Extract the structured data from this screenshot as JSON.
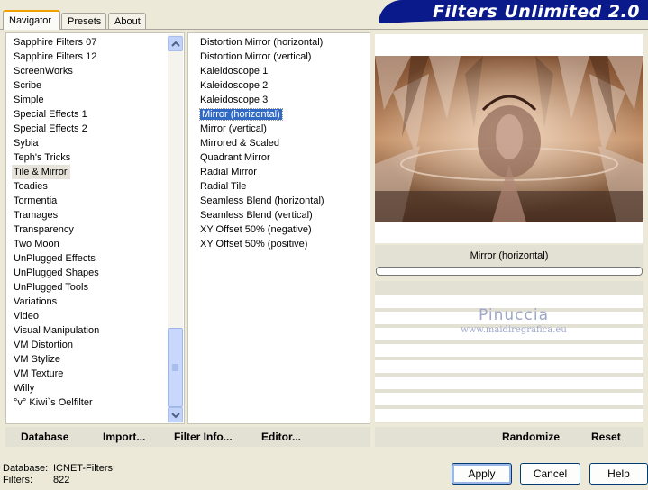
{
  "tabs": [
    "Navigator",
    "Presets",
    "About"
  ],
  "banner_title": "Filters Unlimited 2.0",
  "categories": [
    "Sapphire Filters 07",
    "Sapphire Filters 12",
    "ScreenWorks",
    "Scribe",
    "Simple",
    "Special Effects 1",
    "Special Effects 2",
    "Sybia",
    "Teph's Tricks",
    "Tile & Mirror",
    "Toadies",
    "Tormentia",
    "Tramages",
    "Transparency",
    "Two Moon",
    "UnPlugged Effects",
    "UnPlugged Shapes",
    "UnPlugged Tools",
    "Variations",
    "Video",
    "Visual Manipulation",
    "VM Distortion",
    "VM Stylize",
    "VM Texture",
    "Willy",
    "°v° Kiwi`s Oelfilter"
  ],
  "selected_category": "Tile & Mirror",
  "filters": [
    "Distortion Mirror (horizontal)",
    "Distortion Mirror (vertical)",
    "Kaleidoscope 1",
    "Kaleidoscope 2",
    "Kaleidoscope 3",
    "Mirror (horizontal)",
    "Mirror (vertical)",
    "Mirrored & Scaled",
    "Quadrant Mirror",
    "Radial Mirror",
    "Radial Tile",
    "Seamless Blend (horizontal)",
    "Seamless Blend (vertical)",
    "XY Offset 50% (negative)",
    "XY Offset 50% (positive)"
  ],
  "selected_filter": "Mirror (horizontal)",
  "preview_filter_name": "Mirror (horizontal)",
  "watermark": {
    "name": "Pinuccia",
    "site": "www.maidiregrafica.eu"
  },
  "toolbar": {
    "database": "Database",
    "import": "Import...",
    "filter_info": "Filter Info...",
    "editor": "Editor...",
    "randomize": "Randomize",
    "reset": "Reset"
  },
  "status": {
    "database_label": "Database:",
    "database_value": "ICNET-Filters",
    "filters_label": "Filters:",
    "filters_value": "822"
  },
  "buttons": {
    "apply": "Apply",
    "cancel": "Cancel",
    "help": "Help"
  },
  "colors": {
    "banner": "#0b1a8a",
    "selection": "#316ac5",
    "tab_accent": "#f0a000"
  }
}
